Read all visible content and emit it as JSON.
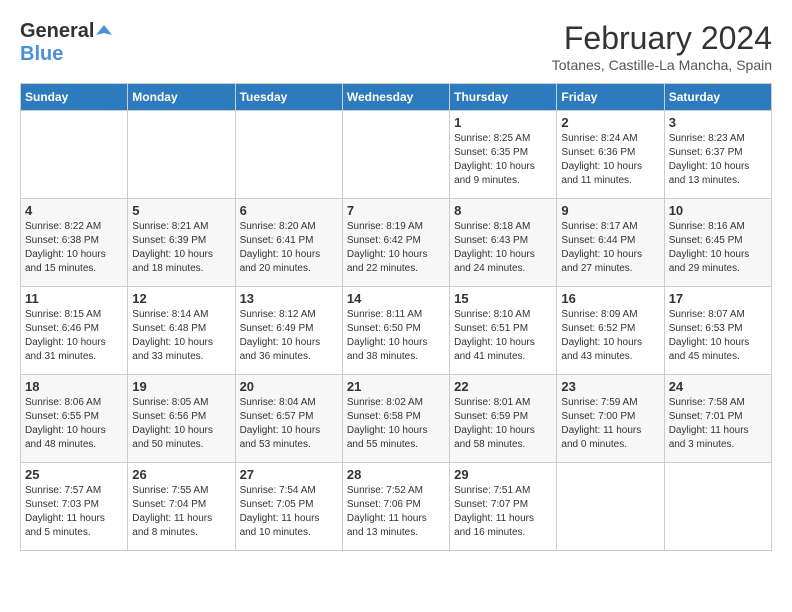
{
  "header": {
    "logo_line1": "General",
    "logo_line2": "Blue",
    "month_title": "February 2024",
    "location": "Totanes, Castille-La Mancha, Spain"
  },
  "days_of_week": [
    "Sunday",
    "Monday",
    "Tuesday",
    "Wednesday",
    "Thursday",
    "Friday",
    "Saturday"
  ],
  "weeks": [
    [
      {
        "day": "",
        "info": ""
      },
      {
        "day": "",
        "info": ""
      },
      {
        "day": "",
        "info": ""
      },
      {
        "day": "",
        "info": ""
      },
      {
        "day": "1",
        "info": "Sunrise: 8:25 AM\nSunset: 6:35 PM\nDaylight: 10 hours\nand 9 minutes."
      },
      {
        "day": "2",
        "info": "Sunrise: 8:24 AM\nSunset: 6:36 PM\nDaylight: 10 hours\nand 11 minutes."
      },
      {
        "day": "3",
        "info": "Sunrise: 8:23 AM\nSunset: 6:37 PM\nDaylight: 10 hours\nand 13 minutes."
      }
    ],
    [
      {
        "day": "4",
        "info": "Sunrise: 8:22 AM\nSunset: 6:38 PM\nDaylight: 10 hours\nand 15 minutes."
      },
      {
        "day": "5",
        "info": "Sunrise: 8:21 AM\nSunset: 6:39 PM\nDaylight: 10 hours\nand 18 minutes."
      },
      {
        "day": "6",
        "info": "Sunrise: 8:20 AM\nSunset: 6:41 PM\nDaylight: 10 hours\nand 20 minutes."
      },
      {
        "day": "7",
        "info": "Sunrise: 8:19 AM\nSunset: 6:42 PM\nDaylight: 10 hours\nand 22 minutes."
      },
      {
        "day": "8",
        "info": "Sunrise: 8:18 AM\nSunset: 6:43 PM\nDaylight: 10 hours\nand 24 minutes."
      },
      {
        "day": "9",
        "info": "Sunrise: 8:17 AM\nSunset: 6:44 PM\nDaylight: 10 hours\nand 27 minutes."
      },
      {
        "day": "10",
        "info": "Sunrise: 8:16 AM\nSunset: 6:45 PM\nDaylight: 10 hours\nand 29 minutes."
      }
    ],
    [
      {
        "day": "11",
        "info": "Sunrise: 8:15 AM\nSunset: 6:46 PM\nDaylight: 10 hours\nand 31 minutes."
      },
      {
        "day": "12",
        "info": "Sunrise: 8:14 AM\nSunset: 6:48 PM\nDaylight: 10 hours\nand 33 minutes."
      },
      {
        "day": "13",
        "info": "Sunrise: 8:12 AM\nSunset: 6:49 PM\nDaylight: 10 hours\nand 36 minutes."
      },
      {
        "day": "14",
        "info": "Sunrise: 8:11 AM\nSunset: 6:50 PM\nDaylight: 10 hours\nand 38 minutes."
      },
      {
        "day": "15",
        "info": "Sunrise: 8:10 AM\nSunset: 6:51 PM\nDaylight: 10 hours\nand 41 minutes."
      },
      {
        "day": "16",
        "info": "Sunrise: 8:09 AM\nSunset: 6:52 PM\nDaylight: 10 hours\nand 43 minutes."
      },
      {
        "day": "17",
        "info": "Sunrise: 8:07 AM\nSunset: 6:53 PM\nDaylight: 10 hours\nand 45 minutes."
      }
    ],
    [
      {
        "day": "18",
        "info": "Sunrise: 8:06 AM\nSunset: 6:55 PM\nDaylight: 10 hours\nand 48 minutes."
      },
      {
        "day": "19",
        "info": "Sunrise: 8:05 AM\nSunset: 6:56 PM\nDaylight: 10 hours\nand 50 minutes."
      },
      {
        "day": "20",
        "info": "Sunrise: 8:04 AM\nSunset: 6:57 PM\nDaylight: 10 hours\nand 53 minutes."
      },
      {
        "day": "21",
        "info": "Sunrise: 8:02 AM\nSunset: 6:58 PM\nDaylight: 10 hours\nand 55 minutes."
      },
      {
        "day": "22",
        "info": "Sunrise: 8:01 AM\nSunset: 6:59 PM\nDaylight: 10 hours\nand 58 minutes."
      },
      {
        "day": "23",
        "info": "Sunrise: 7:59 AM\nSunset: 7:00 PM\nDaylight: 11 hours\nand 0 minutes."
      },
      {
        "day": "24",
        "info": "Sunrise: 7:58 AM\nSunset: 7:01 PM\nDaylight: 11 hours\nand 3 minutes."
      }
    ],
    [
      {
        "day": "25",
        "info": "Sunrise: 7:57 AM\nSunset: 7:03 PM\nDaylight: 11 hours\nand 5 minutes."
      },
      {
        "day": "26",
        "info": "Sunrise: 7:55 AM\nSunset: 7:04 PM\nDaylight: 11 hours\nand 8 minutes."
      },
      {
        "day": "27",
        "info": "Sunrise: 7:54 AM\nSunset: 7:05 PM\nDaylight: 11 hours\nand 10 minutes."
      },
      {
        "day": "28",
        "info": "Sunrise: 7:52 AM\nSunset: 7:06 PM\nDaylight: 11 hours\nand 13 minutes."
      },
      {
        "day": "29",
        "info": "Sunrise: 7:51 AM\nSunset: 7:07 PM\nDaylight: 11 hours\nand 16 minutes."
      },
      {
        "day": "",
        "info": ""
      },
      {
        "day": "",
        "info": ""
      }
    ]
  ]
}
